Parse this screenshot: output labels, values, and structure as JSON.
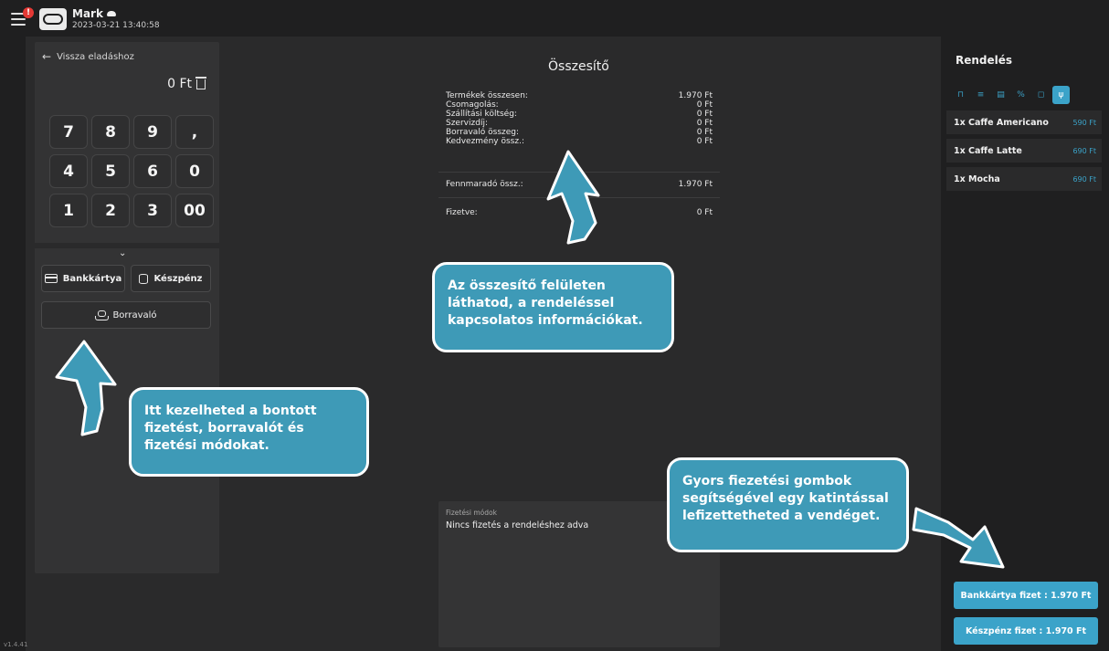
{
  "topbar": {
    "notification_count": "!",
    "user_name": "Mark",
    "datetime": "2023-03-21  13:40:58"
  },
  "version": "v1.4.41",
  "left_panel": {
    "back_label": "Vissza eladáshoz",
    "amount": "0 Ft",
    "keys": [
      "7",
      "8",
      "9",
      ",",
      "4",
      "5",
      "6",
      "0",
      "1",
      "2",
      "3",
      "00"
    ],
    "card_button": "Bankkártya",
    "cash_button": "Készpénz",
    "tip_button": "Borravaló"
  },
  "summary": {
    "title": "Összesítő",
    "rows": [
      {
        "label": "Termékek összesen:",
        "value": "1.970 Ft"
      },
      {
        "label": "Csomagolás:",
        "value": "0 Ft"
      },
      {
        "label": "Szállítási költség:",
        "value": "0 Ft"
      },
      {
        "label": "Szervizdíj:",
        "value": "0 Ft"
      },
      {
        "label": "Borravaló összeg:",
        "value": "0 Ft"
      },
      {
        "label": "Kedvezmény össz.:",
        "value": "0 Ft"
      }
    ],
    "remaining": {
      "label": "Fennmaradó össz.:",
      "value": "1.970 Ft"
    },
    "paid": {
      "label": "Fizetve:",
      "value": "0 Ft"
    }
  },
  "payment_methods": {
    "label": "Fizetési módok",
    "empty_text": "Nincs fizetés a rendeléshez adva"
  },
  "order": {
    "title": "Rendelés",
    "items": [
      {
        "name": "1x Caffe Americano",
        "price": "590 Ft"
      },
      {
        "name": "1x Caffe Latte",
        "price": "690 Ft"
      },
      {
        "name": "1x Mocha",
        "price": "690 Ft"
      }
    ],
    "quick_card": "Bankkártya fizet : 1.970 Ft",
    "quick_cash": "Készpénz fizet : 1.970 Ft"
  },
  "callouts": {
    "summary": [
      "Az összesítő felületen",
      "láthatod, a rendeléssel",
      "kapcsolatos információkat."
    ],
    "left": [
      "Itt kezelheted a bontott",
      "fizetést, borravalót és",
      "fizetési módokat."
    ],
    "quick": [
      "Gyors fiezetési gombok",
      "segítségével egy katintással",
      "lefizettetheted a vendéget."
    ]
  },
  "colors": {
    "accent": "#3ba3c9",
    "callout": "#3e9ab7",
    "badge": "#e53935"
  }
}
